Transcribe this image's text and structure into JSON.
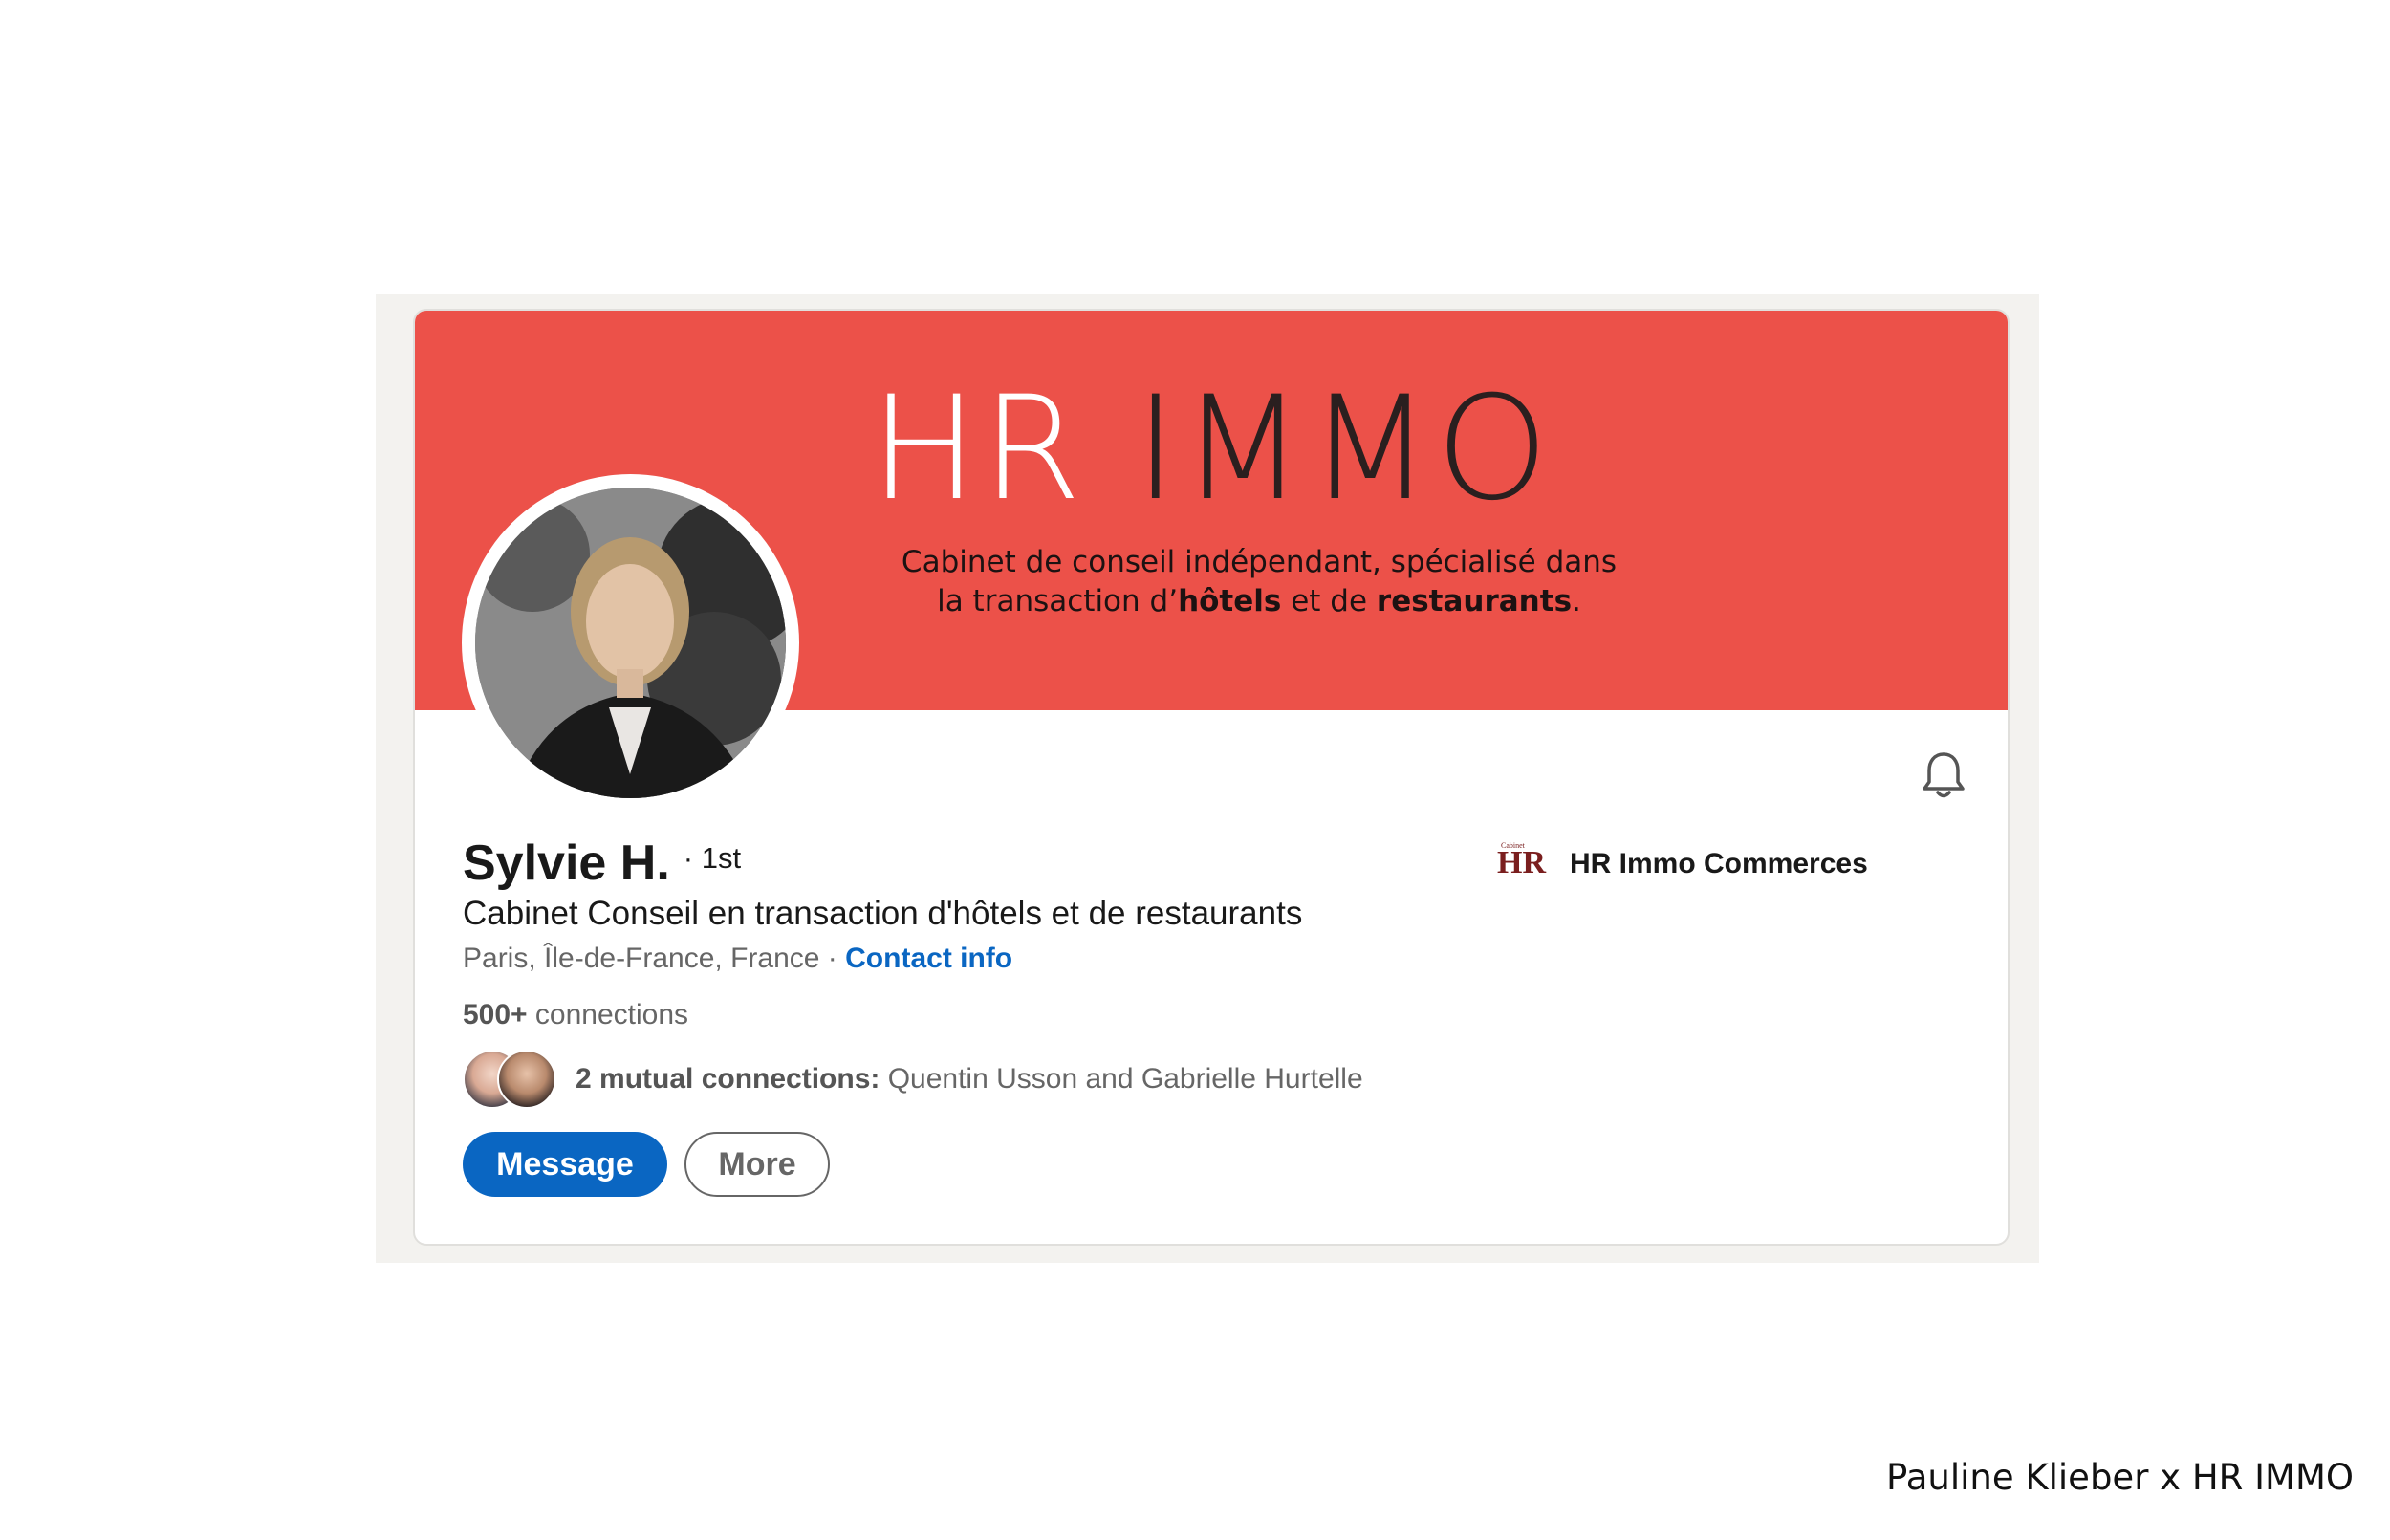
{
  "banner": {
    "brand_hr": "HR",
    "brand_immo": "IMMO",
    "tagline_line1": "Cabinet de conseil indépendant, spécialisé dans",
    "tagline_line2_pre": "la transaction d’",
    "tagline_line2_bold1": "hôtels",
    "tagline_line2_mid": " et de ",
    "tagline_line2_bold2": "restaurants",
    "tagline_line2_end": ".",
    "color": "#ec5149"
  },
  "profile": {
    "name": "Sylvie H.",
    "degree": "· 1st",
    "headline": "Cabinet Conseil en transaction d'hôtels et de restaurants",
    "location": "Paris, Île-de-France, France",
    "separator": " · ",
    "contact_info": "Contact info",
    "connections_count": "500+",
    "connections_label": " connections",
    "mutual_bold": "2 mutual connections:",
    "mutual_names": " Quentin Usson and Gabrielle Hurtelle"
  },
  "company": {
    "logo_small": "Cabinet",
    "logo_big": "HR",
    "name": "HR Immo Commerces"
  },
  "actions": {
    "message_label": "Message",
    "more_label": "More"
  },
  "icons": {
    "notification": "bell-icon"
  },
  "footer": {
    "credit": "Pauline Klieber x HR IMMO"
  },
  "colors": {
    "primary_blue": "#0a66c2",
    "page_bg": "#f3f2ef"
  }
}
